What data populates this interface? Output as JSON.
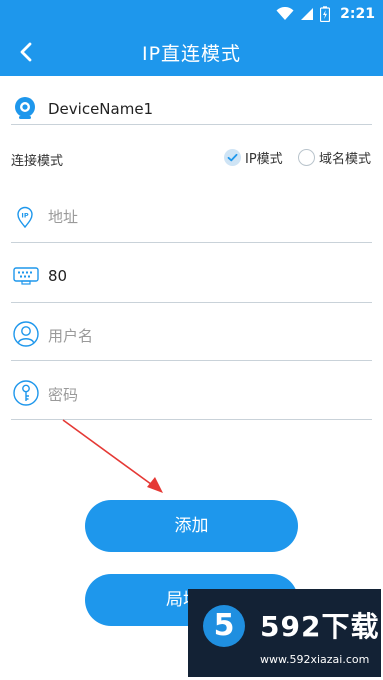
{
  "status_bar": {
    "time": "2:21",
    "icons": [
      "wifi-icon",
      "signal-icon",
      "battery-charging-icon"
    ],
    "color": "#1e97ec"
  },
  "app_bar": {
    "title": "IP直连模式",
    "back_icon": "back-arrow-icon"
  },
  "device_name": {
    "value": "DeviceName1",
    "icon": "camera-icon"
  },
  "connection_mode": {
    "label": "连接模式",
    "options": [
      {
        "label": "IP模式",
        "selected": true
      },
      {
        "label": "域名模式",
        "selected": false
      }
    ]
  },
  "address": {
    "placeholder": "地址",
    "icon": "location-ip-icon"
  },
  "port": {
    "value": "80",
    "icon": "port-icon"
  },
  "username": {
    "placeholder": "用户名",
    "icon": "user-icon"
  },
  "password": {
    "placeholder": "密码",
    "icon": "key-icon"
  },
  "buttons": {
    "add": "添加",
    "lan": "局域网"
  },
  "watermark": {
    "logo": "5",
    "brand": "592下载",
    "url": "www.592xiazai.com"
  },
  "colors": {
    "accent": "#1e97ec",
    "arrow": "#e53935"
  }
}
